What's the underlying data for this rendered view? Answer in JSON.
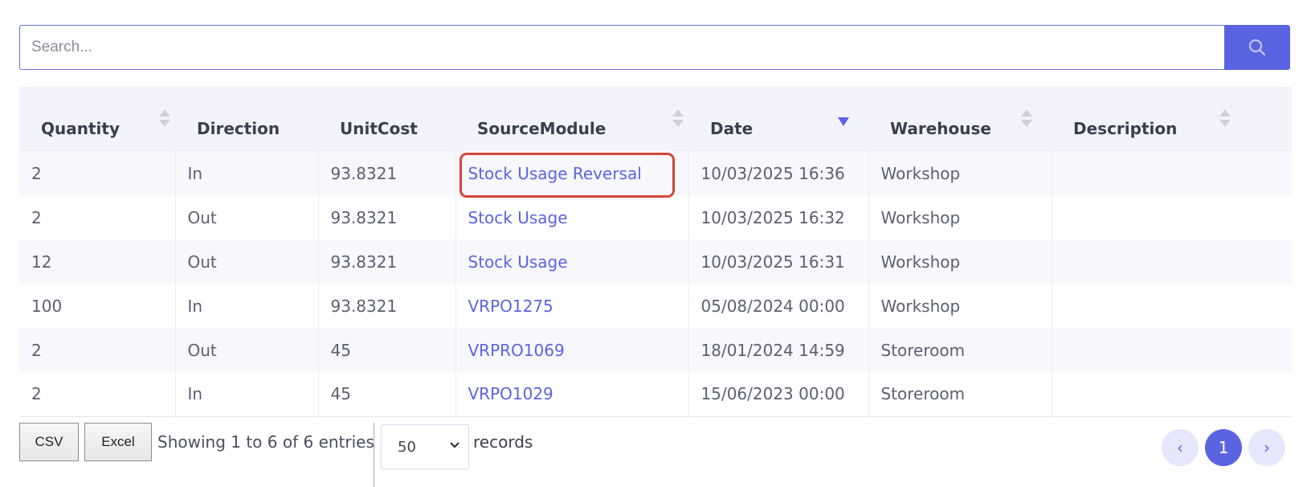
{
  "search": {
    "placeholder": "Search..."
  },
  "table": {
    "columns": [
      "Quantity",
      "Direction",
      "UnitCost",
      "SourceModule",
      "Date",
      "Warehouse",
      "Description"
    ],
    "rows": [
      [
        "2",
        "In",
        "93.8321",
        "Stock Usage Reversal",
        "10/03/2025 16:36",
        "Workshop",
        ""
      ],
      [
        "2",
        "Out",
        "93.8321",
        "Stock Usage",
        "10/03/2025 16:32",
        "Workshop",
        ""
      ],
      [
        "12",
        "Out",
        "93.8321",
        "Stock Usage",
        "10/03/2025 16:31",
        "Workshop",
        ""
      ],
      [
        "100",
        "In",
        "93.8321",
        "VRPO1275",
        "05/08/2024 00:00",
        "Workshop",
        ""
      ],
      [
        "2",
        "Out",
        "45",
        "VRPRO1069",
        "18/01/2024 14:59",
        "Storeroom",
        ""
      ],
      [
        "2",
        "In",
        "45",
        "VRPO1029",
        "15/06/2023 00:00",
        "Storeroom",
        ""
      ]
    ],
    "sorted_column": "Date",
    "sort_direction": "desc"
  },
  "footer": {
    "csv_label": "CSV",
    "excel_label": "Excel",
    "info": "Showing 1 to 6 of 6 entries",
    "page_size": "50",
    "records_label": "records",
    "prev_label": "‹",
    "current_page": "1",
    "next_label": "›"
  },
  "colors": {
    "accent": "#5b64e0",
    "highlight": "#d6463a",
    "stripe": "#f7f7fc",
    "header_bg": "#f3f3fc"
  }
}
